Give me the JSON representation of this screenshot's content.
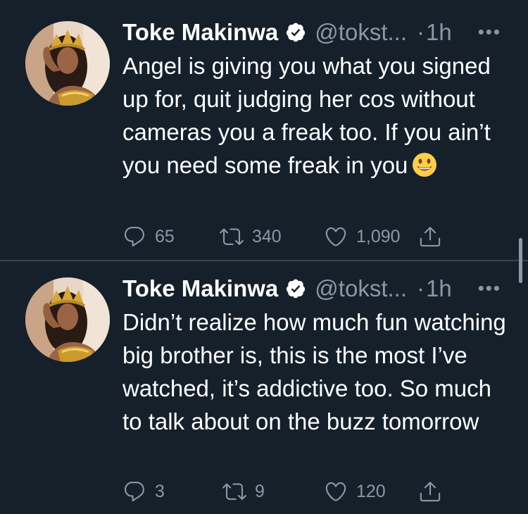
{
  "colors": {
    "background": "#15202b",
    "divider": "#38444d",
    "secondary_text": "#8899a6",
    "verified_badge": "#ffffff"
  },
  "tweets": [
    {
      "author": "Toke Makinwa",
      "handle": "@tokst...",
      "separator": "·",
      "time": "1h",
      "more": "•••",
      "text": "Angel is giving you what you signed up for, quit judging her cos without cameras you a freak too. If you ain’t you need some freak in you",
      "emoji": "grinning-face-icon",
      "replies": "65",
      "retweets": "340",
      "likes": "1,090"
    },
    {
      "author": "Toke Makinwa",
      "handle": "@tokst...",
      "separator": "·",
      "time": "1h",
      "more": "•••",
      "text": "Didn’t realize how much fun watching big brother is, this is the most I’ve watched, it’s addictive too. So much to talk about on the buzz tomorrow",
      "replies": "3",
      "retweets": "9",
      "likes": "120"
    }
  ],
  "icons": {
    "reply": "reply-icon",
    "retweet": "retweet-icon",
    "like": "heart-icon",
    "share": "share-icon",
    "verified": "verified-badge-icon"
  }
}
